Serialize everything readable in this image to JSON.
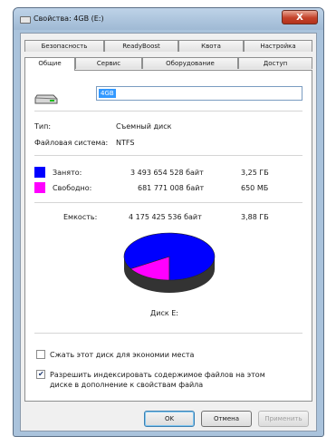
{
  "window": {
    "title": "Свойства: 4GB (E:)",
    "close_label": "X"
  },
  "tabs_row1": [
    {
      "label": "Безопасность"
    },
    {
      "label": "ReadyBoost"
    },
    {
      "label": "Квота"
    },
    {
      "label": "Настройка"
    }
  ],
  "tabs_row2": [
    {
      "label": "Общие"
    },
    {
      "label": "Сервис"
    },
    {
      "label": "Оборудование"
    },
    {
      "label": "Доступ"
    }
  ],
  "general": {
    "drive_name_value": "4GB",
    "type_label": "Тип:",
    "type_value": "Съемный диск",
    "fs_label": "Файловая система:",
    "fs_value": "NTFS",
    "used_label": "Занято:",
    "used_bytes": "3 493 654 528 байт",
    "used_size": "3,25 ГБ",
    "free_label": "Свободно:",
    "free_bytes": "681 771 008 байт",
    "free_size": "650 МБ",
    "capacity_label": "Емкость:",
    "capacity_bytes": "4 175 425 536 байт",
    "capacity_size": "3,88 ГБ",
    "disk_label": "Диск E:",
    "compress_label": "Сжать этот диск для экономии места",
    "compress_checked": false,
    "index_label_line1": "Разрешить индексировать содержимое файлов на этом",
    "index_label_line2": "диске в дополнение к свойствам файла",
    "index_checked": true
  },
  "usage": {
    "used_fraction": 0.837,
    "used_color": "#0000ff",
    "free_color": "#ff00ff"
  },
  "buttons": {
    "ok": "OK",
    "cancel": "Отмена",
    "apply": "Применить"
  }
}
